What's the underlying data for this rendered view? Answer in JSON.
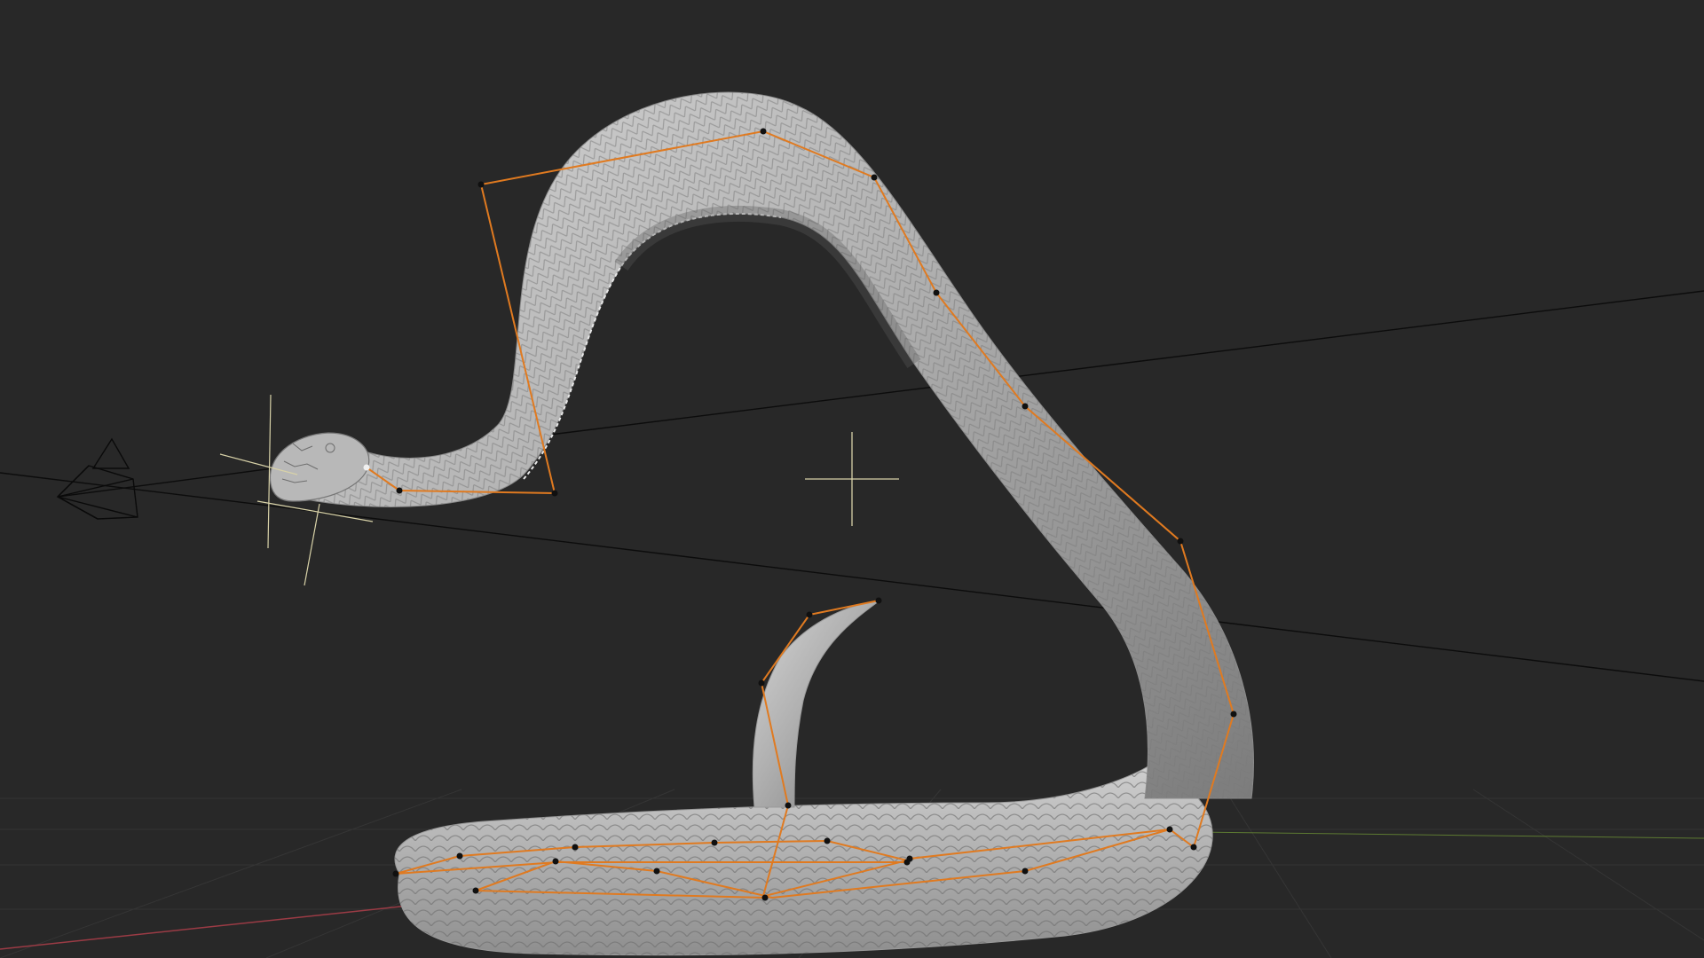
{
  "viewport": {
    "background": "#282828",
    "grid_color": "#3a3a3a",
    "x_axis_color": "#9b3b45",
    "y_axis_color": "#6a8a3a",
    "empty_color": "#d8d2a8",
    "curve_color": "#e07a20",
    "point_color": "#101010",
    "mesh_color": "#b4b4b4",
    "scale_shadow_color": "#7a7a7a",
    "guide_line_color": "#0c0c0c"
  },
  "objects": {
    "camera": "camera-icon",
    "main_empty": "plain-axes-empty",
    "target_empty": "target-cross-empty",
    "snake": "snake-mesh",
    "curve": "bezier-curve-control-polygon"
  }
}
